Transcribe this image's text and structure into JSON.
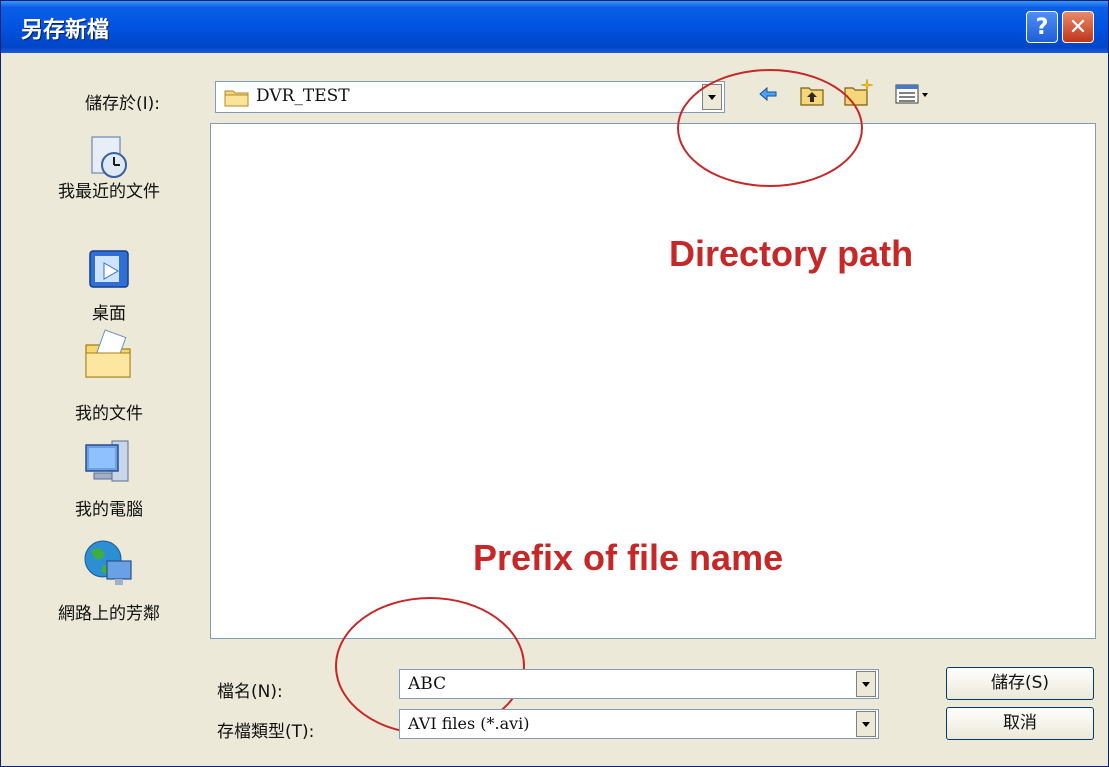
{
  "window": {
    "title": "另存新檔",
    "help_label": "?",
    "close_label": "✕"
  },
  "savein": {
    "label": "儲存於(I):",
    "value": "DVR_TEST"
  },
  "toolbar": {
    "icons": [
      "back-icon",
      "up-folder-icon",
      "new-folder-icon",
      "view-menu-icon"
    ]
  },
  "places": [
    {
      "label": "我最近的文件",
      "icon": "recent-documents-icon"
    },
    {
      "label": "桌面",
      "icon": "desktop-icon"
    },
    {
      "label": "我的文件",
      "icon": "my-documents-icon"
    },
    {
      "label": "我的電腦",
      "icon": "my-computer-icon"
    },
    {
      "label": "網路上的芳鄰",
      "icon": "network-places-icon"
    }
  ],
  "filename": {
    "label": "檔名(N):",
    "value": "ABC"
  },
  "filetype": {
    "label": "存檔類型(T):",
    "value": "AVI files (*.avi)"
  },
  "buttons": {
    "save": "儲存(S)",
    "cancel": "取消"
  },
  "annotations": {
    "directory": "Directory path",
    "prefix": "Prefix of file name"
  },
  "colors": {
    "annotation": "#c62828",
    "titlebar": "#0053e1",
    "dialog_bg": "#ece9d8"
  }
}
